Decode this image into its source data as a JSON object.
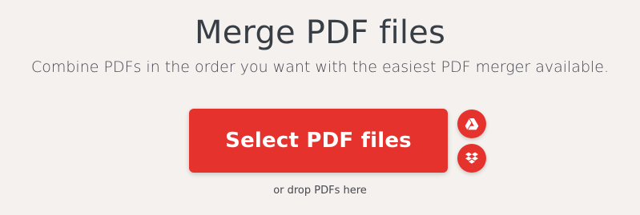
{
  "hero": {
    "title": "Merge PDF files",
    "subtitle": "Combine PDFs in the order you want with the easiest PDF merger available."
  },
  "upload": {
    "select_label": "Select PDF files",
    "drop_hint": "or drop PDFs here"
  },
  "cloud_sources": [
    {
      "name": "google-drive-icon"
    },
    {
      "name": "dropbox-icon"
    }
  ],
  "colors": {
    "accent": "#e5322d",
    "background": "#f4f1ee",
    "text": "#383e45"
  }
}
